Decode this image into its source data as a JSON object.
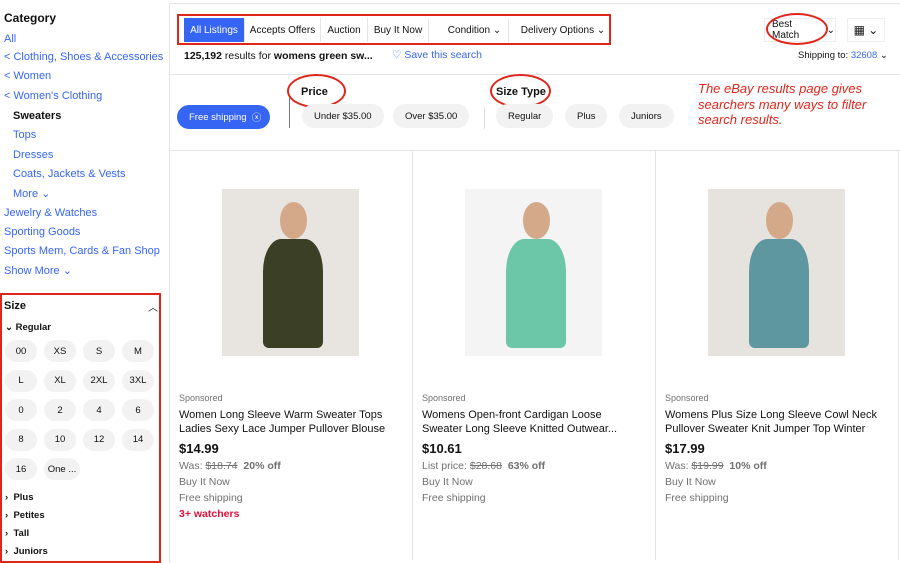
{
  "sidebar": {
    "category_heading": "Category",
    "links": [
      "All",
      "< Clothing, Shoes & Accessories",
      "< Women",
      "< Women's Clothing"
    ],
    "current": "Sweaters",
    "subcats": [
      "Tops",
      "Dresses",
      "Coats, Jackets & Vests",
      "More ⌄"
    ],
    "other": [
      "Jewelry & Watches",
      "Sporting Goods",
      "Sports Mem, Cards & Fan Shop",
      "Show More ⌄"
    ],
    "size": {
      "heading": "Size",
      "regular_label": "Regular",
      "sizes": [
        "00",
        "XS",
        "S",
        "M",
        "L",
        "XL",
        "2XL",
        "3XL",
        "0",
        "2",
        "4",
        "6",
        "8",
        "10",
        "12",
        "14",
        "16",
        "One ..."
      ],
      "groups": [
        "Plus",
        "Petites",
        "Tall",
        "Juniors"
      ]
    }
  },
  "toolbar": {
    "tabs": [
      "All Listings",
      "Accepts Offers",
      "Auction",
      "Buy It Now"
    ],
    "dropdowns": [
      "Condition",
      "Delivery Options"
    ],
    "sort": "Best Match",
    "view_icon": "grid-icon",
    "shipping_label": "Shipping to:",
    "zip": "32608"
  },
  "results": {
    "count": "125,192",
    "mid": " results for ",
    "query": "womens green sw...",
    "save": "Save this search"
  },
  "filters": {
    "free_shipping": "Free shipping",
    "price_heading": "Price",
    "price": [
      "Under $35.00",
      "Over $35.00"
    ],
    "size_type_heading": "Size Type",
    "size_types": [
      "Regular",
      "Plus",
      "Juniors"
    ]
  },
  "annotation": "The eBay results page gives searchers many ways to filter search results.",
  "colors": {
    "accent": "#3665f3",
    "annotation": "#e0261b",
    "watchers": "#e0103a"
  },
  "products": [
    {
      "sponsored": "Sponsored",
      "title": "Women Long Sleeve Warm Sweater Tops Ladies Sexy Lace Jumper Pullover Blouse",
      "price": "$14.99",
      "was_label": "Was: ",
      "was": "$18.74",
      "off": "20% off",
      "format": "Buy It Now",
      "shipping": "Free shipping",
      "watchers": "3+ watchers"
    },
    {
      "sponsored": "Sponsored",
      "title": "Womens Open-front Cardigan Loose Sweater Long Sleeve Knitted Outwear...",
      "price": "$10.61",
      "was_label": "List price: ",
      "was": "$28.68",
      "off": "63% off",
      "format": "Buy It Now",
      "shipping": "Free shipping"
    },
    {
      "sponsored": "Sponsored",
      "title": "Womens Plus Size Long Sleeve Cowl Neck Pullover Sweater Knit Jumper Top Winter",
      "price": "$17.99",
      "was_label": "Was: ",
      "was": "$19.99",
      "off": "10% off",
      "format": "Buy It Now",
      "shipping": "Free shipping"
    }
  ]
}
